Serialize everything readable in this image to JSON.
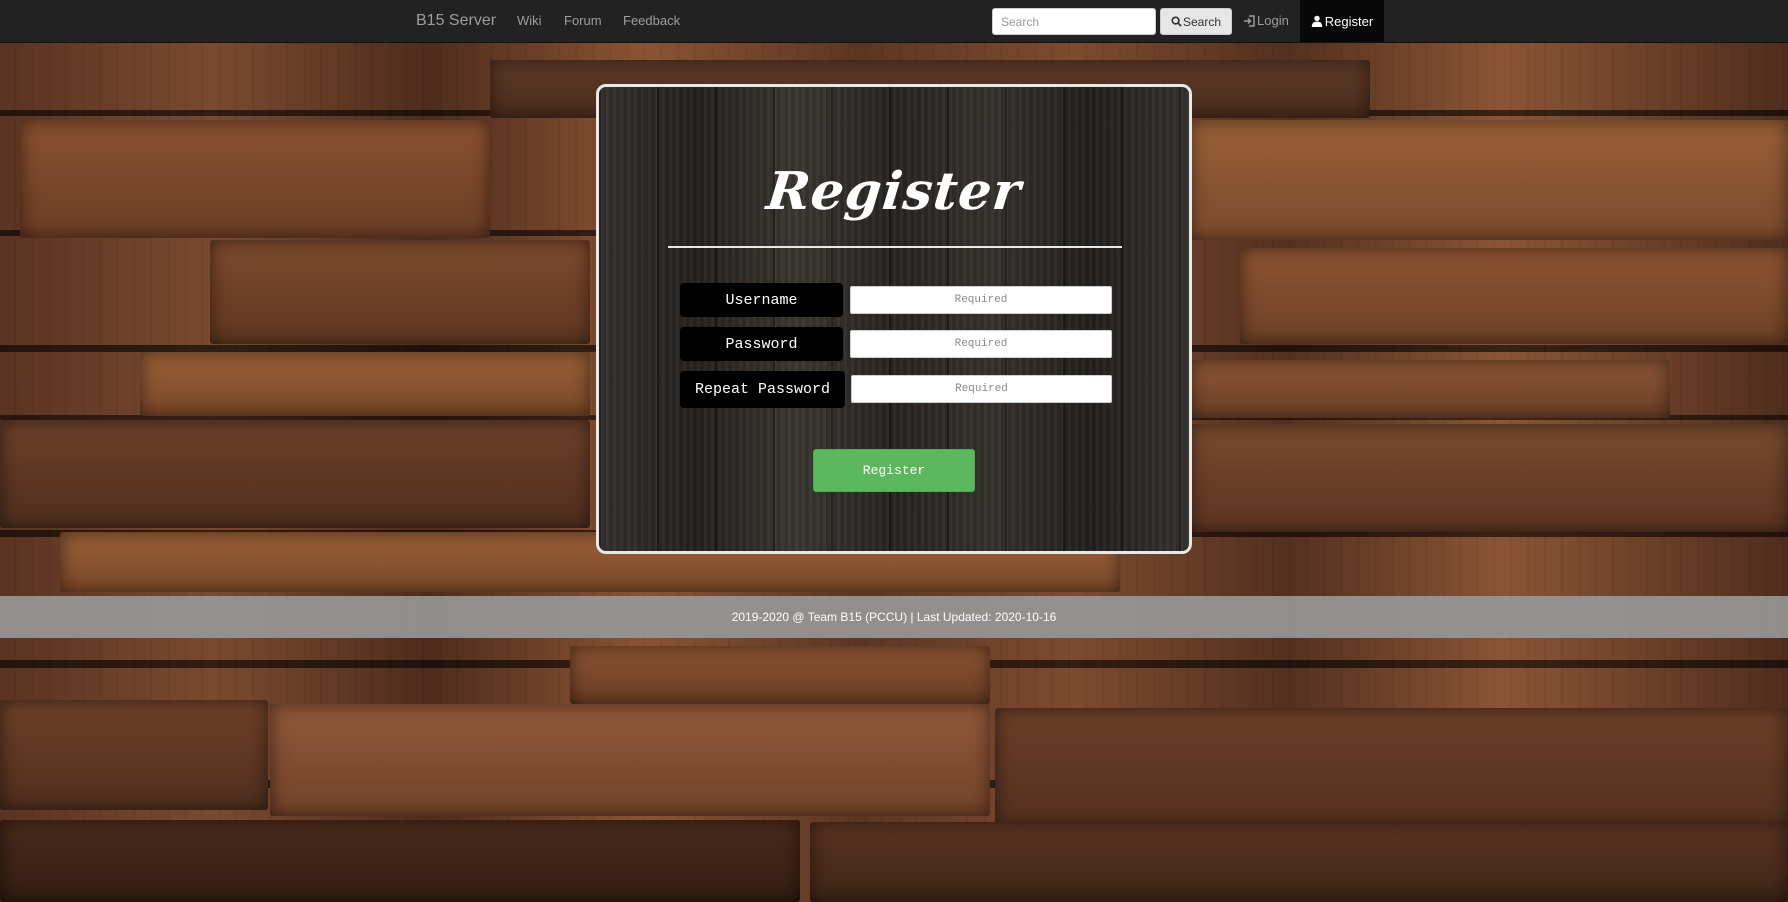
{
  "navbar": {
    "brand": "B15 Server",
    "links": [
      "Wiki",
      "Forum",
      "Feedback"
    ],
    "search_placeholder": "Search",
    "search_button": "Search",
    "login": "Login",
    "register": "Register"
  },
  "form": {
    "title": "Register",
    "fields": [
      {
        "label": "Username",
        "placeholder": "Required"
      },
      {
        "label": "Password",
        "placeholder": "Required"
      },
      {
        "label": "Repeat Password",
        "placeholder": "Required"
      }
    ],
    "submit_label": "Register"
  },
  "footer": {
    "text": "2019-2020 @ Team B15 (PCCU) | Last Updated: 2020-10-16"
  },
  "colors": {
    "navbar_bg": "#222222",
    "active_nav_bg": "#080808",
    "submit_bg": "#5cb85c",
    "footer_bg": "#969696"
  }
}
